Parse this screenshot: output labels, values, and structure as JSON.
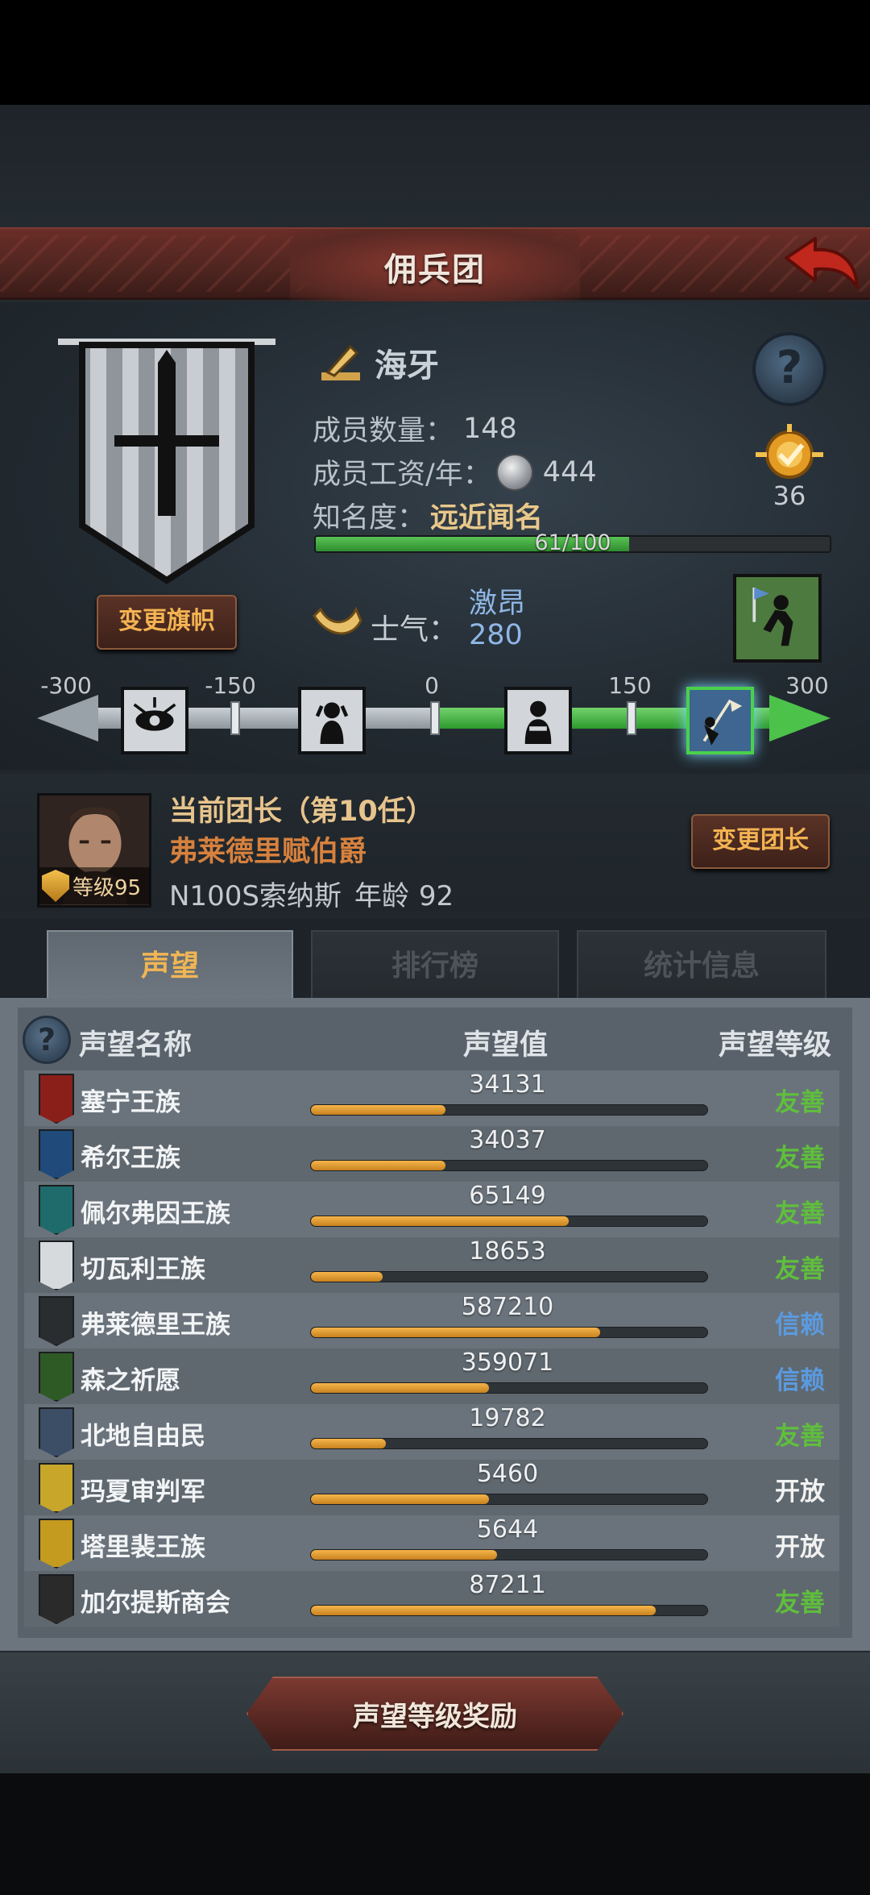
{
  "header": {
    "title": "佣兵团"
  },
  "company": {
    "name": "海牙",
    "members_label": "成员数量：",
    "members": "148",
    "salary_label": "成员工资/年：",
    "salary": "444",
    "fame_label": "知名度：",
    "fame_value": "远近闻名",
    "fame_progress_text": "61/100",
    "fame_progress": 0.61,
    "change_flag_label": "变更旗帜",
    "rank": "36"
  },
  "morale": {
    "label": "士气：",
    "word": "激昂",
    "value": "280",
    "scale": {
      "ticks": [
        "-300",
        "-150",
        "0",
        "150",
        "300"
      ],
      "min": -300,
      "max": 300,
      "current": 280
    }
  },
  "leader": {
    "title": "当前团长（第10任）",
    "name": "弗莱德里赋伯爵",
    "info": "N100S索纳斯",
    "age_label": "年龄",
    "age": "92",
    "level": "等级95",
    "change_label": "变更团长"
  },
  "tabs": [
    "声望",
    "排行榜",
    "统计信息"
  ],
  "table": {
    "headers": {
      "name": "声望名称",
      "value": "声望值",
      "level": "声望等级"
    },
    "rows": [
      {
        "name": "塞宁王族",
        "value": "34131",
        "progress": 0.34,
        "level": "友善",
        "icon_color": "#8a1f1a"
      },
      {
        "name": "希尔王族",
        "value": "34037",
        "progress": 0.34,
        "level": "友善",
        "icon_color": "#1f4a7a"
      },
      {
        "name": "佩尔弗因王族",
        "value": "65149",
        "progress": 0.65,
        "level": "友善",
        "icon_color": "#1f6b6b"
      },
      {
        "name": "切瓦利王族",
        "value": "18653",
        "progress": 0.18,
        "level": "友善",
        "icon_color": "#d7dadc"
      },
      {
        "name": "弗莱德里王族",
        "value": "587210",
        "progress": 0.73,
        "level": "信赖",
        "icon_color": "#2a2d30"
      },
      {
        "name": "森之祈愿",
        "value": "359071",
        "progress": 0.45,
        "level": "信赖",
        "icon_color": "#2e5a26"
      },
      {
        "name": "北地自由民",
        "value": "19782",
        "progress": 0.19,
        "level": "友善",
        "icon_color": "#3c4e66"
      },
      {
        "name": "玛夏审判军",
        "value": "5460",
        "progress": 0.45,
        "level": "开放",
        "icon_color": "#c8a62a"
      },
      {
        "name": "塔里裴王族",
        "value": "5644",
        "progress": 0.47,
        "level": "开放",
        "icon_color": "#c49a1f"
      },
      {
        "name": "加尔提斯商会",
        "value": "87211",
        "progress": 0.87,
        "level": "友善",
        "icon_color": "#2a2a2a"
      }
    ]
  },
  "colors": {
    "level_friendly": "#5fbf3c",
    "level_trusted": "#5a9ae0",
    "level_open": "#f2f2f2"
  },
  "footer": {
    "reward_label": "声望等级奖励"
  }
}
